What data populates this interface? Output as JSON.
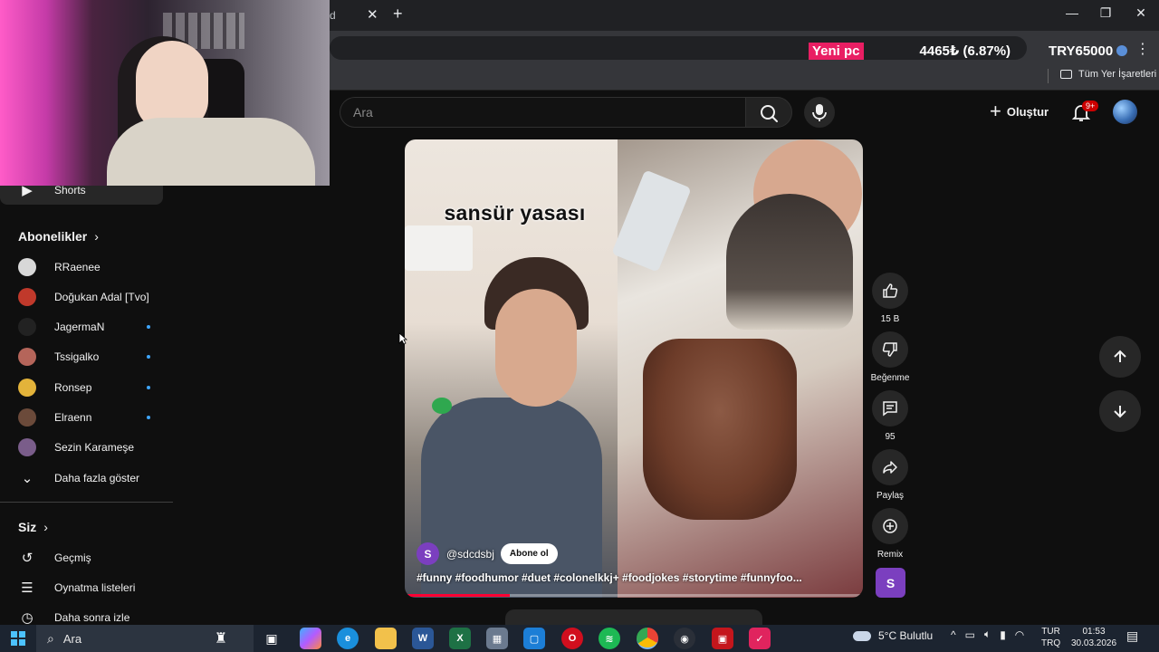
{
  "browser": {
    "tab_fragment": "d",
    "tab_close": "✕",
    "new_tab": "+",
    "window": {
      "minimize": "—",
      "restore": "❐",
      "close": "✕"
    },
    "ticker": {
      "label": "Yeni pc",
      "change": "4465₺ (6.87%)",
      "price": "TRY65000"
    },
    "menu": "⋮",
    "bookmarks_all": "Tüm Yer İşaretleri"
  },
  "header": {
    "search_placeholder": "Ara",
    "create_label": "Oluştur",
    "notif_badge": "9+"
  },
  "sidebar": {
    "shorts_label": "Shorts",
    "subscriptions_title": "Abonelikler",
    "subscriptions": [
      {
        "label": "RRaenee",
        "color": "#d8d8d8",
        "new": false
      },
      {
        "label": "Doğukan Adal [Tvo]",
        "color": "#c0392b",
        "new": false
      },
      {
        "label": "JagermaN",
        "color": "#222222",
        "new": true
      },
      {
        "label": "Tssigalko",
        "color": "#b5655a",
        "new": true
      },
      {
        "label": "Ronsep",
        "color": "#e3b33a",
        "new": true
      },
      {
        "label": "Elraenn",
        "color": "#6b4a3a",
        "new": true
      },
      {
        "label": "Sezin Karameşe",
        "color": "#7a5d8a",
        "new": false
      }
    ],
    "show_more": "Daha fazla göster",
    "you_title": "Siz",
    "you_items": [
      "Geçmiş",
      "Oynatma listeleri",
      "Daha sonra izle"
    ]
  },
  "player": {
    "overlay_caption": "sansür yasası",
    "channel_initial": "S",
    "channel_handle": "@sdcdsbj",
    "subscribe_label": "Abone ol",
    "hashtags": "#funny #foodhumor #duet #colonelkkj+ #foodjokes #storytime #funnyfoo...",
    "progress": 0.23
  },
  "actions": {
    "like_count": "15 B",
    "dislike_label": "Beğenme",
    "comment_count": "95",
    "share_label": "Paylaş",
    "remix_label": "Remix",
    "channel_initial": "S"
  },
  "taskbar": {
    "search_label": "Ara",
    "weather": "5°C  Bulutlu",
    "lang_line1": "TUR",
    "lang_line2": "TRQ",
    "time": "01:53",
    "date": "30.03.2026"
  }
}
